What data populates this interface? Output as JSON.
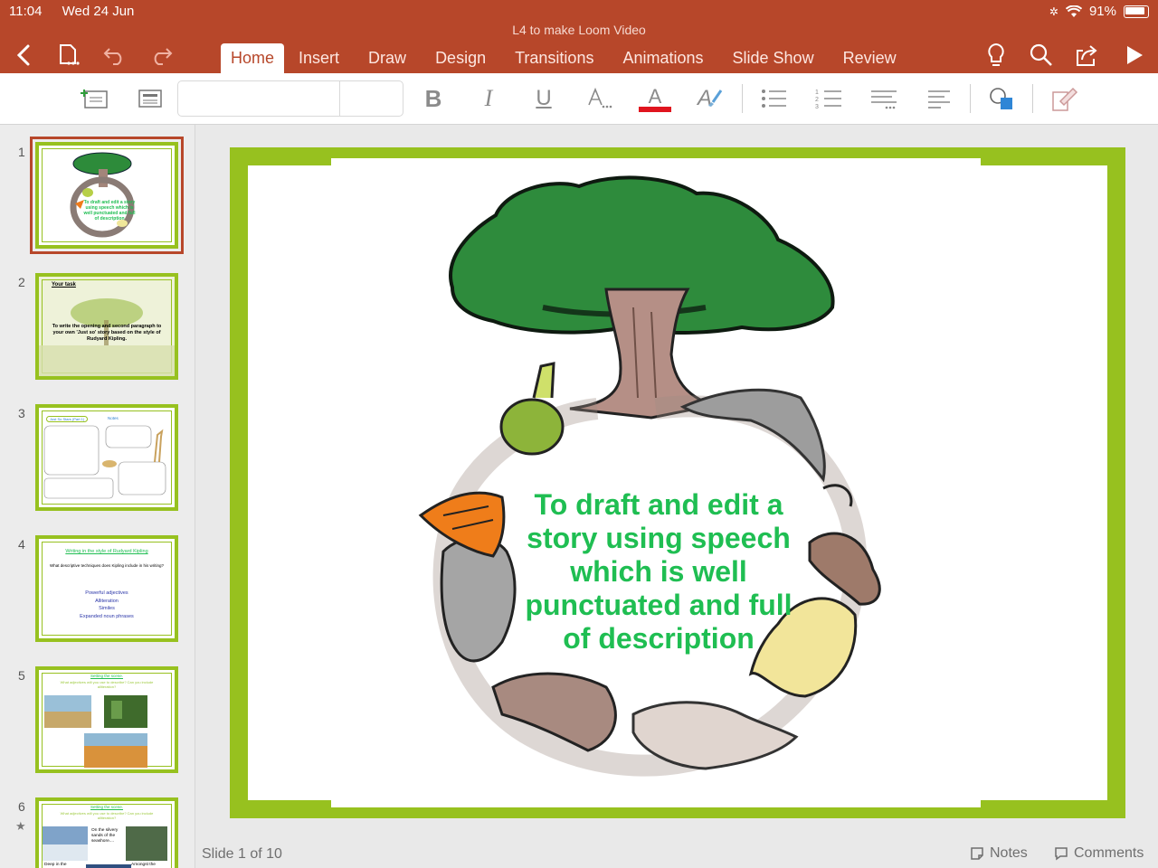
{
  "status": {
    "time": "11:04",
    "date": "Wed 24 Jun",
    "battery": "91%"
  },
  "document": {
    "title": "L4 to make Loom Video"
  },
  "tabs": [
    {
      "label": "Home",
      "active": true
    },
    {
      "label": "Insert"
    },
    {
      "label": "Draw"
    },
    {
      "label": "Design"
    },
    {
      "label": "Transitions"
    },
    {
      "label": "Animations"
    },
    {
      "label": "Slide Show"
    },
    {
      "label": "Review"
    }
  ],
  "ribbon": {
    "bold": "B",
    "italic": "I",
    "underline": "U",
    "font_color": "A",
    "text_effects": "A",
    "font_color_hex": "#e0141e"
  },
  "colors": {
    "accent": "#b7472a",
    "slide_border": "#97c11f",
    "slide_text": "#1fbe52"
  },
  "thumbnails": [
    {
      "number": "1",
      "text": "To draft and edit a story using speech which is well punctuated and full of description"
    },
    {
      "number": "2",
      "title": "Your task",
      "text": "To write the opening and second paragraph to your own 'Just so' story based on the style of Rudyard Kipling."
    },
    {
      "number": "3",
      "title": "Just So Stars (Part 1)",
      "notes_label": "Notes"
    },
    {
      "number": "4",
      "title": "Writing in the style of Rudyard Kipling",
      "question": "What descriptive techniques does Kipling include in his writing?",
      "items": [
        "Powerful adjectives",
        "Alliteration",
        "Similes",
        "Expanded noun phrases"
      ]
    },
    {
      "number": "5",
      "title": "Setting the scene.",
      "question": "What adjectives will you use to describe? Can you include alliteration?"
    },
    {
      "number": "6",
      "title": "Setting the scene.",
      "question": "What adjectives will you use to describe? Can you include alliteration?",
      "caption": "On the silvery sands of the seashore....",
      "caption2": "Deep in the",
      "caption3": "Amongst the"
    }
  ],
  "slide": {
    "text_lines": [
      "To draft and edit a",
      "story using speech",
      "which is well",
      "punctuated and full",
      "of description"
    ]
  },
  "statusbar": {
    "slide_count": "Slide 1 of 10",
    "notes": "Notes",
    "comments": "Comments"
  }
}
